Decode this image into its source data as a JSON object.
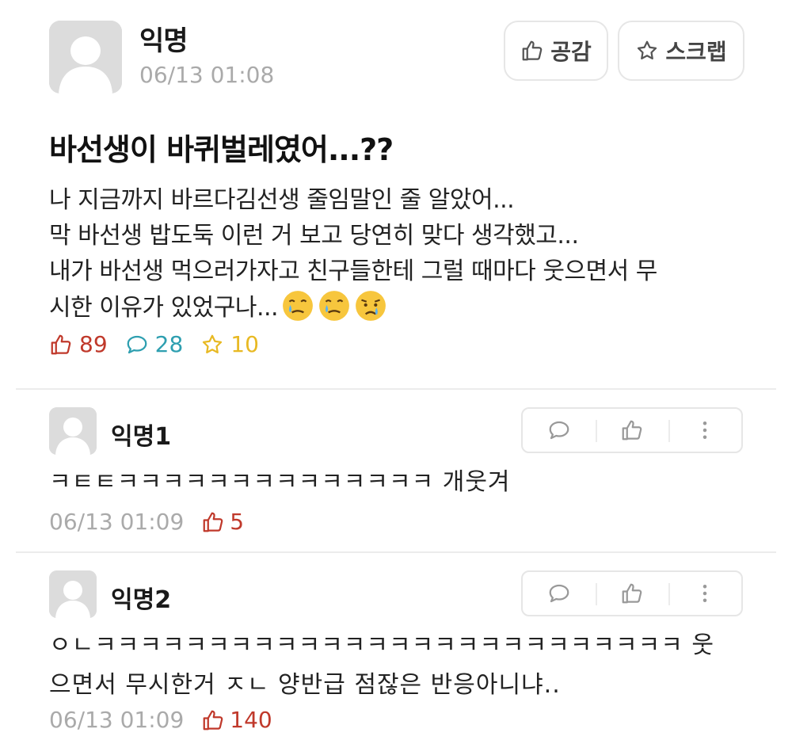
{
  "post": {
    "author": "익명",
    "time": "06/13 01:08",
    "like_button": "공감",
    "scrap_button": "스크랩",
    "title": "바선생이 바퀴벌레였어...??",
    "body_lines": [
      "나 지금까지 바르다김선생 줄임말인 줄 알았어...",
      "막 바선생 밥도둑 이런 거 보고 당연히 맞다 생각했고...",
      "내가 바선생 먹으러가자고 친구들한테 그럴 때마다 웃으면서 무",
      "시한 이유가 있었구나..."
    ],
    "emojis": [
      "face-holding-back-tears",
      "face-holding-back-tears",
      "crying-face"
    ],
    "likes": "89",
    "comments": "28",
    "scraps": "10"
  },
  "comments": [
    {
      "author": "익명1",
      "lines": [
        "ㅋㅌㅌㅋㅋㅋㅋㅋㅋㅋㅋㅋㅋㅋㅋㅋㅋ 개웃겨"
      ],
      "time": "06/13 01:09",
      "likes": "5"
    },
    {
      "author": "익명2",
      "lines": [
        "ㅇㄴㅋㅋㅋㅋㅋㅋㅋㅋㅋㅋㅋㅋㅋㅋㅋㅋㅋㅋㅋㅋㅋㅋㅋㅋㅋㅋ 웃",
        "으면서 무시한거 ㅈㄴ 양반급 점잖은 반응아니냐.."
      ],
      "time": "06/13 01:09",
      "likes": "140"
    }
  ],
  "colors": {
    "like": "#c0392b",
    "comment": "#2e9fb0",
    "scrap": "#e8b923",
    "muted": "#aaaaaa"
  }
}
